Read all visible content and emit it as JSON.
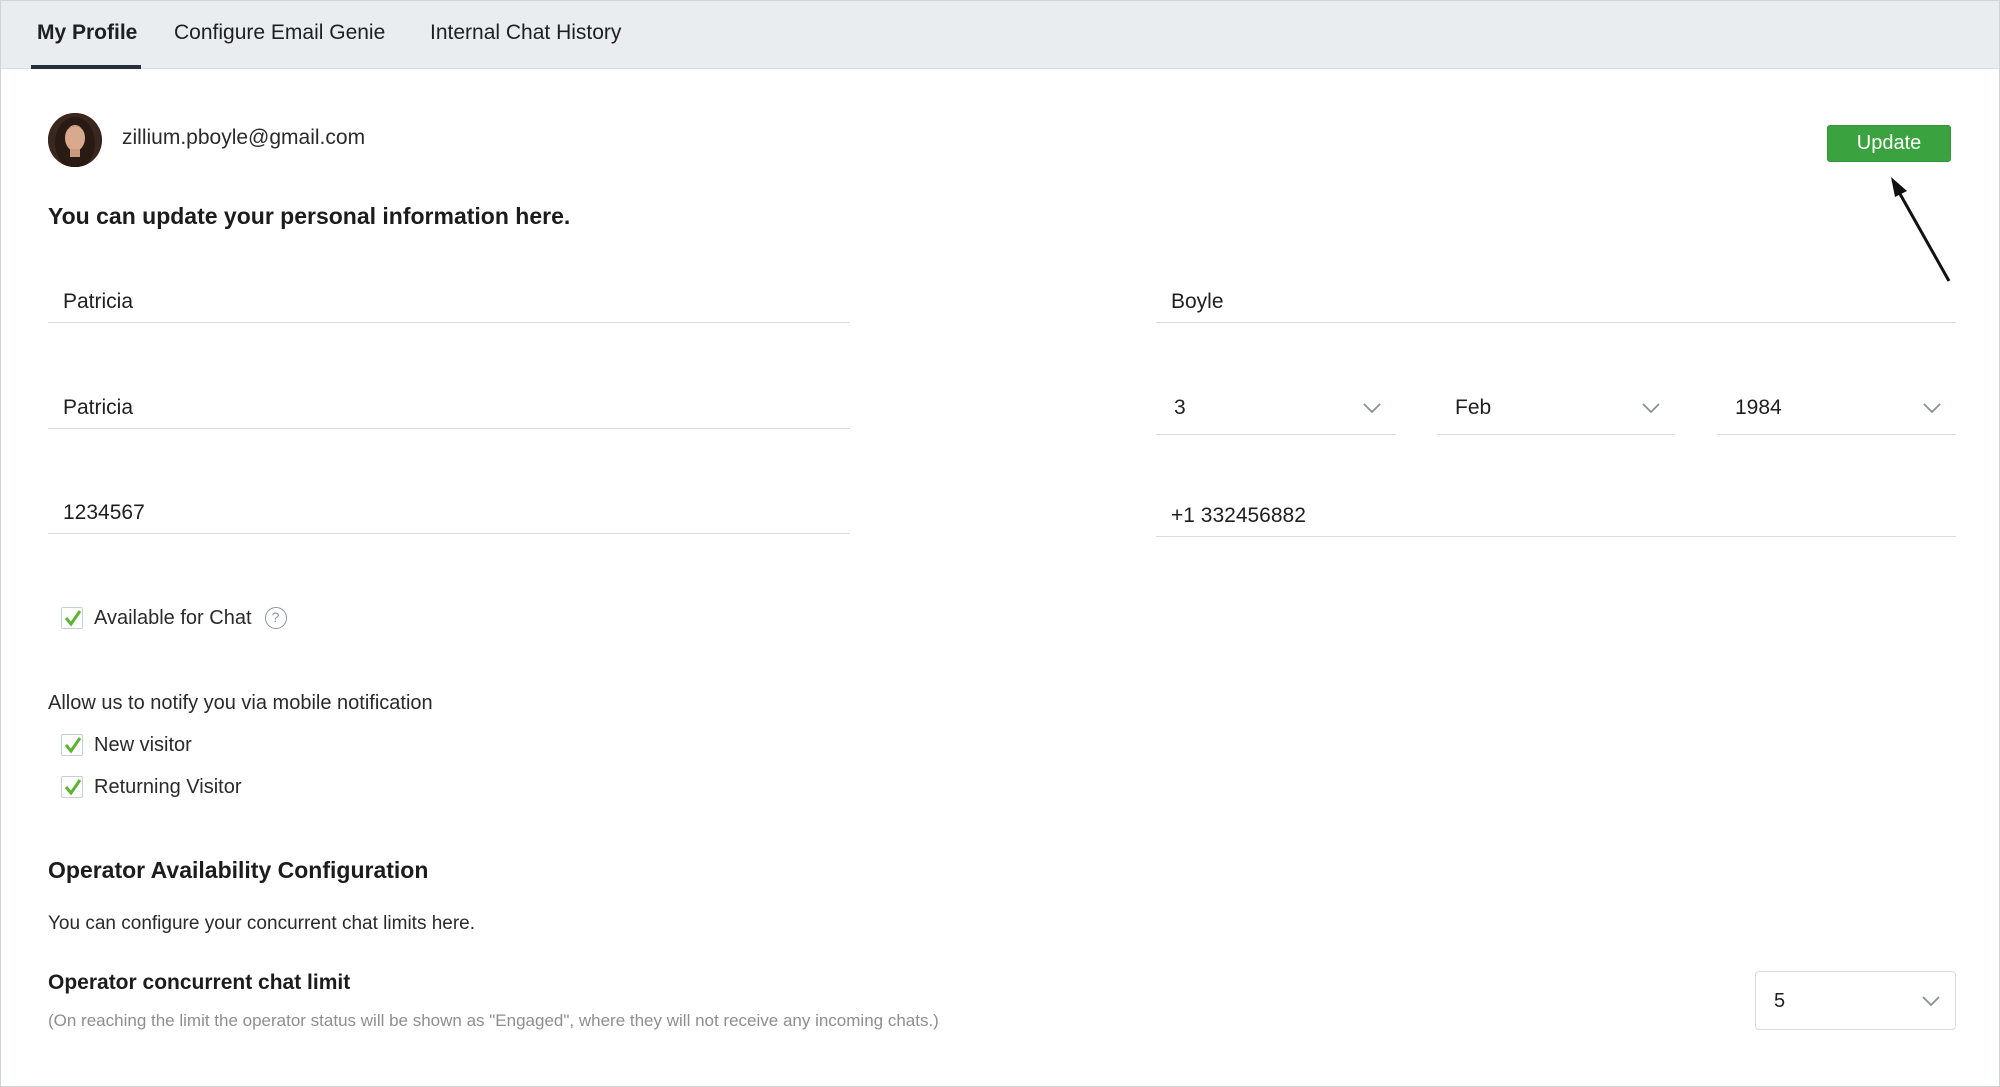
{
  "tabs": [
    {
      "label": "My Profile",
      "active": true
    },
    {
      "label": "Configure Email Genie",
      "active": false
    },
    {
      "label": "Internal Chat History",
      "active": false
    }
  ],
  "profile": {
    "email": "zillium.pboyle@gmail.com",
    "update_label": "Update",
    "intro": "You can update your personal information here."
  },
  "fields": {
    "first_name": "Patricia",
    "last_name": "Boyle",
    "display_name": "Patricia",
    "employee_id": "1234567",
    "phone": "+1 332456882",
    "dob_day": "3",
    "dob_month": "Feb",
    "dob_year": "1984"
  },
  "chat": {
    "available_label": "Available for Chat",
    "available_checked": true,
    "help_glyph": "?"
  },
  "notifications": {
    "heading": "Allow us to notify you via mobile notification",
    "new_visitor_label": "New visitor",
    "returning_visitor_label": "Returning Visitor"
  },
  "availability": {
    "title": "Operator Availability Configuration",
    "description": "You can configure your concurrent chat limits here.",
    "limit_title": "Operator concurrent chat limit",
    "limit_note": "(On reaching the limit the operator status will be shown as \"Engaged\", where they will not receive any incoming chats.)",
    "limit_value": "5"
  },
  "colors": {
    "accent_green": "#3aa23f",
    "check_green": "#5cb531",
    "tab_bar": "#e9edf0"
  },
  "icons": [
    "chevron-down-icon",
    "check-icon",
    "help-icon",
    "arrow-annotation-icon"
  ]
}
